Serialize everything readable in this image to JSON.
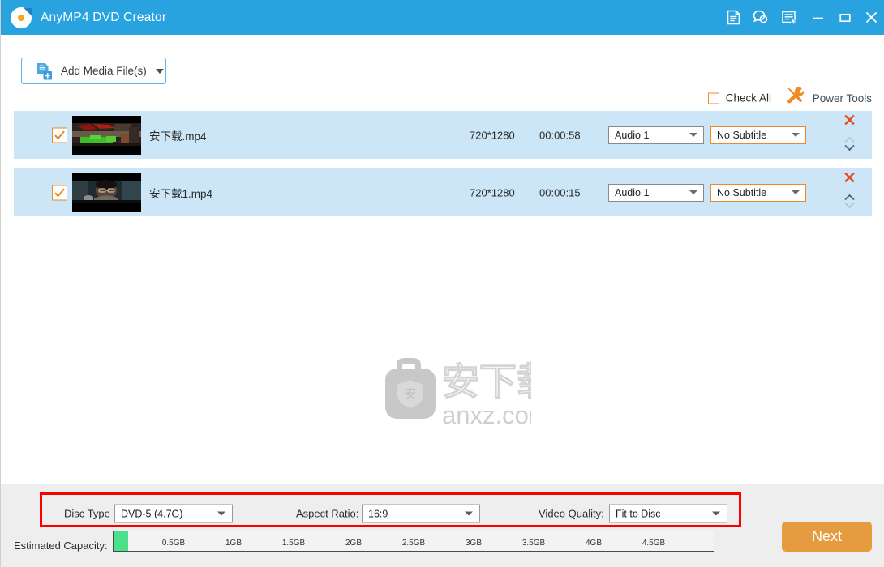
{
  "window": {
    "title": "AnyMP4 DVD Creator",
    "logo_icon": "disc-logo-icon",
    "controls": [
      {
        "name": "register-icon",
        "label": "Register"
      },
      {
        "name": "support-icon",
        "label": "Support"
      },
      {
        "name": "menu-icon",
        "label": "Menu"
      },
      {
        "name": "minimize-icon",
        "label": "Minimize"
      },
      {
        "name": "maximize-icon",
        "label": "Maximize"
      },
      {
        "name": "close-icon",
        "label": "Close"
      }
    ]
  },
  "toolbar": {
    "add_media_label": "Add Media File(s)",
    "add_media_icon": "add-file-icon",
    "check_all_label": "Check All",
    "check_all_checked": false,
    "power_tools_label": "Power Tools",
    "power_tools_icon": "wrench-screwdriver-icon"
  },
  "files": [
    {
      "checked": true,
      "name": "安下载.mp4",
      "resolution": "720*1280",
      "duration": "00:00:58",
      "audio": "Audio 1",
      "subtitle": "No Subtitle"
    },
    {
      "checked": true,
      "name": "安下载1.mp4",
      "resolution": "720*1280",
      "duration": "00:00:15",
      "audio": "Audio 1",
      "subtitle": "No Subtitle"
    }
  ],
  "watermark": {
    "cn_text": "安下载",
    "domain_text": "anxz.com",
    "badge_char": "安"
  },
  "settings": {
    "disc_type_label": "Disc Type",
    "disc_type_value": "DVD-5 (4.7G)",
    "aspect_ratio_label": "Aspect Ratio:",
    "aspect_ratio_value": "16:9",
    "video_quality_label": "Video Quality:",
    "video_quality_value": "Fit to Disc"
  },
  "capacity": {
    "label": "Estimated Capacity:",
    "fill_percent": 2.4,
    "ticks": [
      "0.5GB",
      "1GB",
      "1.5GB",
      "2GB",
      "2.5GB",
      "3GB",
      "3.5GB",
      "4GB",
      "4.5GB"
    ]
  },
  "actions": {
    "next_label": "Next"
  },
  "colors": {
    "titlebar": "#29a3e0",
    "accent_orange": "#e98a28",
    "next_button": "#e59b3f",
    "row_selected": "#cce6f7",
    "highlight_box": "#fb0000",
    "capacity_fill": "#4de08a"
  }
}
